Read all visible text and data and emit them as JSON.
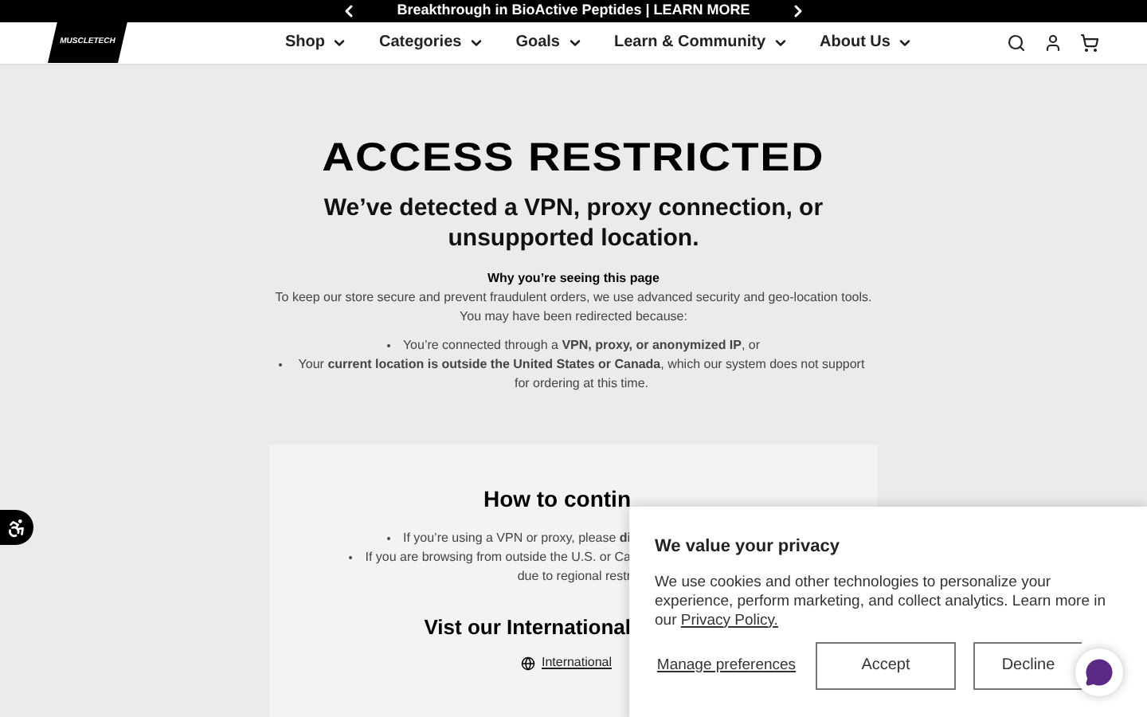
{
  "announcement": {
    "text": "Breakthrough in BioActive Peptides | LEARN MORE"
  },
  "nav": {
    "logo": "MUSCLETECH",
    "items": [
      {
        "label": "Shop"
      },
      {
        "label": "Categories"
      },
      {
        "label": "Goals"
      },
      {
        "label": "Learn & Community"
      },
      {
        "label": "About Us"
      }
    ]
  },
  "main": {
    "title": "ACCESS RESTRICTED",
    "subtitle": "We’ve detected a VPN, proxy connection, or unsupported location.",
    "why_heading": "Why you’re seeing this page",
    "why_text": "To keep our store secure and prevent fraudulent orders, we use advanced security and geo-location tools. You may have been redirected because:",
    "reasons": [
      "You’re connected through a **VPN, proxy, or anonymized IP**, or",
      "Your **current location is outside the United States or Canada**, which our system does not support for ordering at this time."
    ]
  },
  "continue_card": {
    "heading": "How to contin",
    "steps": [
      "If you’re using a VPN or proxy, please **di**",
      "If you are browsing from outside the U.S. or Ca"
    ],
    "steps_more": "due to regional restr",
    "intl_heading": "Vist our International",
    "intl_link": "International"
  },
  "cookie_banner": {
    "title": "We value your privacy",
    "text": "We use cookies and other technologies to personalize your experience, perform marketing, and collect analytics. Learn more in our",
    "policy_link": "Privacy Policy.",
    "manage": "Manage preferences",
    "accept": "Accept",
    "decline": "Decline"
  }
}
